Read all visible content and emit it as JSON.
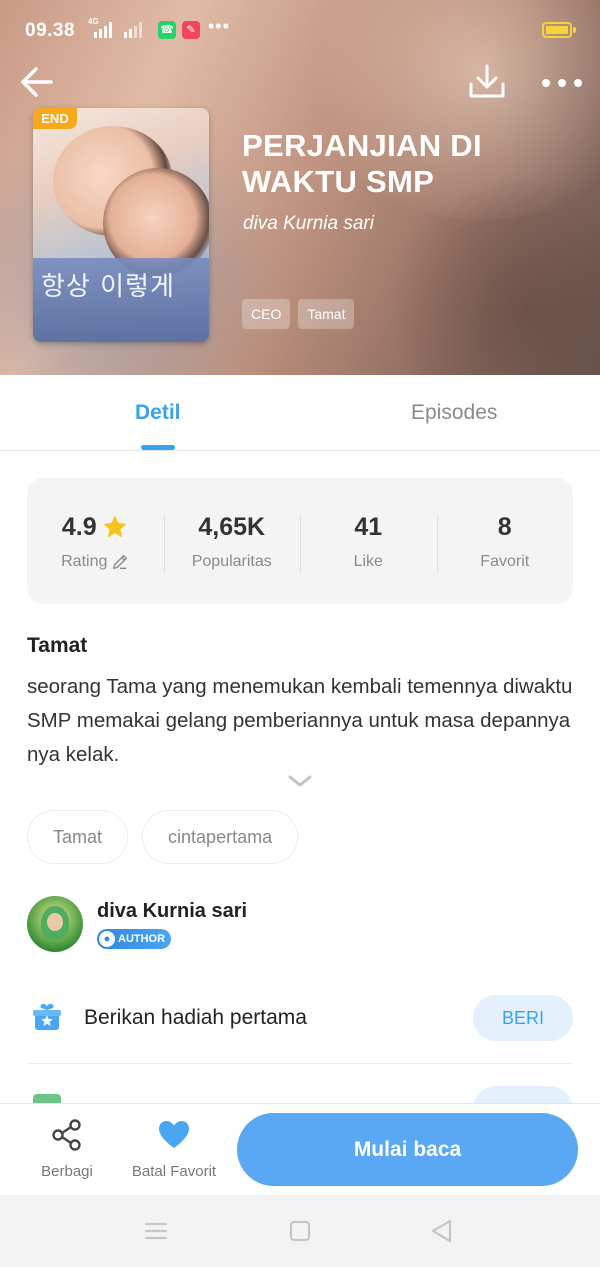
{
  "status_bar": {
    "time": "09.38",
    "network": "4G",
    "dots": "•••",
    "apps": [
      {
        "icon": "whatsapp-icon",
        "glyph": "☎",
        "color": "#25d366"
      },
      {
        "icon": "notification-app-icon",
        "glyph": "✎",
        "color": "#f0475f"
      }
    ]
  },
  "header": {
    "end_badge": "END",
    "cover_title": "항상 이렇게",
    "title": "PERJANJIAN DI WAKTU SMP",
    "author": "diva Kurnia sari",
    "genres": [
      "CEO",
      "Tamat"
    ]
  },
  "tabs": {
    "detail": "Detil",
    "episodes": "Episodes",
    "active": "detail"
  },
  "stats": [
    {
      "value": "4.9",
      "label": "Rating",
      "icon": "star-icon",
      "label_icon": "pencil-icon"
    },
    {
      "value": "4,65K",
      "label": "Popularitas"
    },
    {
      "value": "41",
      "label": "Like"
    },
    {
      "value": "8",
      "label": "Favorit"
    }
  ],
  "synopsis": {
    "status": "Tamat",
    "text": "seorang Tama yang menemukan kembali temennya diwaktu SMP memakai gelang pemberiannya untuk masa depannya nya kelak."
  },
  "keywords": [
    "Tamat",
    "cintapertama"
  ],
  "author": {
    "name": "diva Kurnia sari",
    "badge": "AUTHOR"
  },
  "gift": {
    "label": "Berikan hadiah pertama",
    "button": "BERI"
  },
  "bottom_bar": {
    "share": "Berbagi",
    "favorite": "Batal Favorit",
    "read": "Mulai baca"
  },
  "colors": {
    "accent": "#3aa1ea",
    "read_button": "#5aa7f3",
    "end_badge": "#f7a81b",
    "star": "#f7c21b",
    "heart": "#4aa6f2"
  }
}
